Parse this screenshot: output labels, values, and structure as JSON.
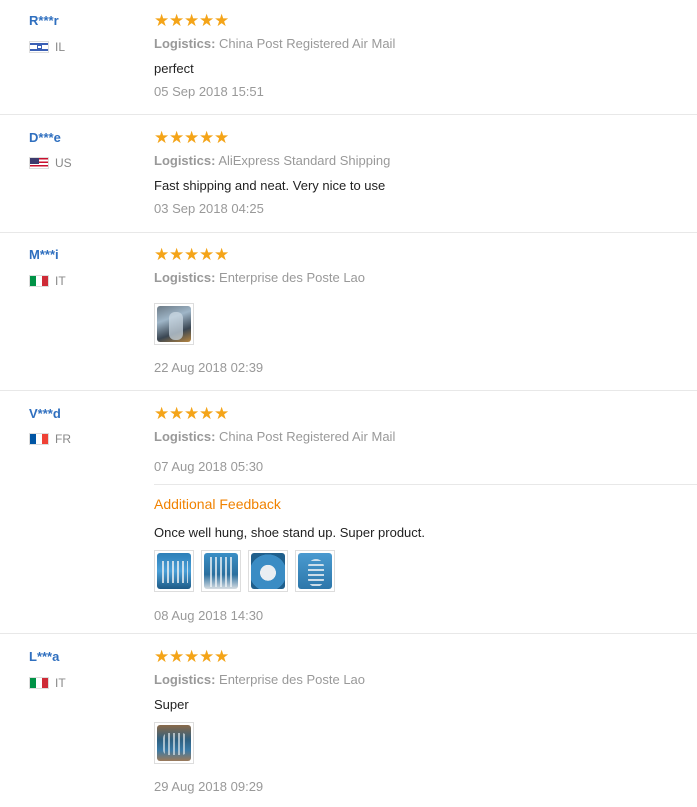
{
  "reviews": [
    {
      "user": "R***r",
      "country": "IL",
      "flag": "il-flag-icon",
      "logistics_label": "Logistics:",
      "logistics_value": "China Post Registered Air Mail",
      "text": "perfect",
      "date": "05 Sep 2018 15:51",
      "rating": 5
    },
    {
      "user": "D***e",
      "country": "US",
      "flag": "us-flag-icon",
      "logistics_label": "Logistics:",
      "logistics_value": "AliExpress Standard Shipping",
      "text": "Fast shipping and neat. Very nice to use",
      "date": "03 Sep 2018 04:25",
      "rating": 5
    },
    {
      "user": "M***i",
      "country": "IT",
      "flag": "it-flag-icon",
      "logistics_label": "Logistics:",
      "logistics_value": "Enterprise des Poste Lao",
      "text": "",
      "date": "22 Aug 2018 02:39",
      "rating": 5
    },
    {
      "user": "V***d",
      "country": "FR",
      "flag": "fr-flag-icon",
      "logistics_label": "Logistics:",
      "logistics_value": "China Post Registered Air Mail",
      "text": "",
      "date": "07 Aug 2018 05:30",
      "additional_title": "Additional Feedback",
      "additional_text": "Once well hung, shoe stand up. Super product.",
      "additional_date": "08 Aug 2018 14:30",
      "rating": 5
    },
    {
      "user": "L***a",
      "country": "IT",
      "flag": "it-flag-icon",
      "logistics_label": "Logistics:",
      "logistics_value": "Enterprise des Poste Lao",
      "text": "Super",
      "date": "29 Aug 2018 09:29",
      "rating": 5
    }
  ],
  "colors": {
    "star": "#f4a418",
    "username": "#2f6fbf",
    "additional": "#f08200"
  }
}
